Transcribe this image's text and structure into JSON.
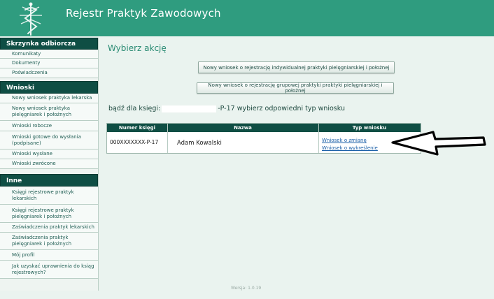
{
  "app": {
    "title": "Rejestr Praktyk Zawodowych"
  },
  "sidebar": {
    "inbox": {
      "title": "Skrzynka odbiorcza",
      "items": [
        "Komunikaty",
        "Dokumenty",
        "Poświadczenia"
      ]
    },
    "applications": {
      "title": "Wnioski",
      "items": [
        "Nowy wniosek praktyka lekarska",
        "Nowy wniosek praktyka pielęgniarek i położnych",
        "Wnioski robocze",
        "Wnioski gotowe do wysłania (podpisane)",
        "Wnioski wysłane",
        "Wnioski zwrócone"
      ]
    },
    "other": {
      "title": "Inne",
      "items": [
        "Księgi rejestrowe praktyk lekarskich",
        "Księgi rejestrowe praktyk pielęgniarek i położnych",
        "Zaświadczenia praktyk lekarskich",
        "Zaświadczenia praktyk pielęgniarek i położnych",
        "Mój profil",
        "Jak uzyskać uprawnienia do ksiąg rejestrowych?"
      ]
    }
  },
  "main": {
    "title": "Wybierz akcję",
    "buttons": {
      "individual": "Nowy wniosek o rejestrację indywidualnej praktyki pielęgniarskiej i położnej",
      "group": "Nowy wniosek o rejestrację grupowej praktyki praktyki pielęgniarskiej i położnej"
    },
    "choose_prefix": "bądź dla księgi:",
    "choose_suffix": "-P-17 wybierz odpowiedni typ wniosku",
    "table": {
      "headers": [
        "Numer księgi",
        "Nazwa",
        "Typ wniosku"
      ],
      "rows": [
        {
          "number": "000XXXXXXX-P-17",
          "name": "Adam Kowalski",
          "links": [
            "Wniosek o zmianę",
            "Wniosek o wykreślenie"
          ]
        }
      ]
    }
  },
  "footer": {
    "version": "Wersja: 1.0.19"
  },
  "colors": {
    "header": "#2f9c7f",
    "section": "#0f4e44",
    "link": "#1a5fa8"
  },
  "icons": {
    "logo": "medical-caduceus-icon",
    "annotation": "arrow-left-icon"
  }
}
